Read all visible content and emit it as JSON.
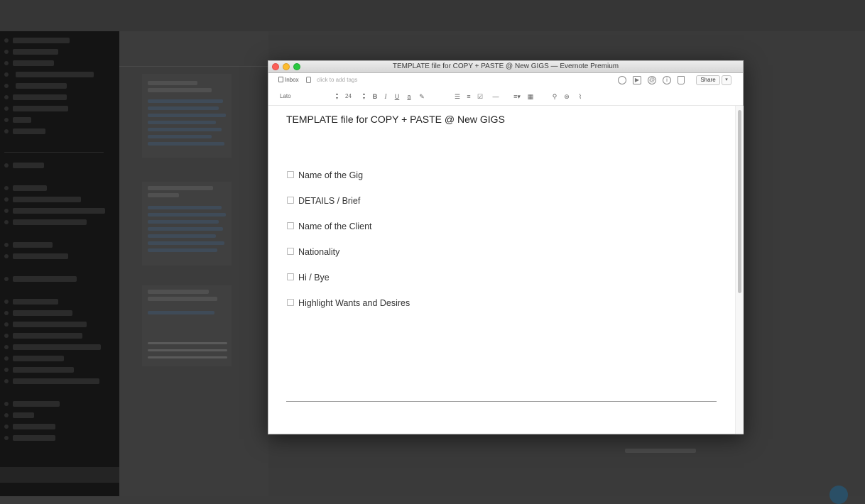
{
  "window": {
    "title": "TEMPLATE file for COPY + PASTE @ New GIGS — Evernote Premium"
  },
  "meta": {
    "notebook": "Inbox",
    "tags_placeholder": "click to add tags",
    "share_label": "Share",
    "icons": [
      "alarm-icon",
      "presentation-icon",
      "at-icon",
      "info-icon",
      "trash-icon"
    ]
  },
  "toolbar": {
    "font": "Lato",
    "size": "24"
  },
  "note": {
    "title": "TEMPLATE file for COPY + PASTE @ New GIGS",
    "checklist": [
      {
        "label": "Name of the Gig",
        "checked": false
      },
      {
        "label": "DETAILS / Brief",
        "checked": false
      },
      {
        "label": "Name of the Client",
        "checked": false
      },
      {
        "label": "Nationality",
        "checked": false
      },
      {
        "label": "Hi / Bye",
        "checked": false
      },
      {
        "label": "Highlight Wants and Desires",
        "checked": false
      }
    ]
  },
  "colors": {
    "close": "#fc5f57",
    "minimize": "#fdbc2e",
    "zoom": "#28c840"
  }
}
